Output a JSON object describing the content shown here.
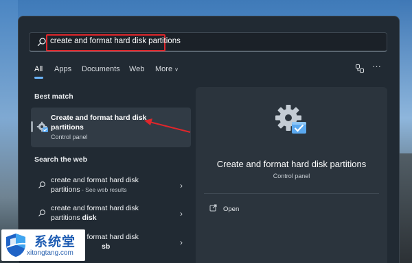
{
  "search": {
    "query": "create and format hard disk partitions",
    "highlight_color": "#e0262b"
  },
  "tabs": [
    {
      "label": "All",
      "active": true
    },
    {
      "label": "Apps"
    },
    {
      "label": "Documents"
    },
    {
      "label": "Web"
    },
    {
      "label": "More"
    }
  ],
  "toolbar": {
    "share_icon": "share-devices-icon",
    "more_icon": "more-ellipsis-icon",
    "more_glyph": "···"
  },
  "best_match": {
    "heading": "Best match",
    "title": "Create and format hard disk partitions",
    "subtitle": "Control panel",
    "icon": "disk-management-gear-icon"
  },
  "web": {
    "heading": "Search the web",
    "items": [
      {
        "line1": "create and format hard disk",
        "line2": "partitions",
        "suffix": " - See web results"
      },
      {
        "line1": "create and format hard disk",
        "line2_prefix": "partitions ",
        "line2_bold": "disk"
      },
      {
        "line1": "create and format hard disk",
        "line2_bold": "sb"
      }
    ]
  },
  "detail": {
    "title": "Create and format hard disk partitions",
    "subtitle": "Control panel",
    "actions": [
      {
        "label": "Open",
        "icon": "open-external-icon"
      }
    ]
  },
  "watermark": {
    "title": "系统堂",
    "url": "xitongtang.com"
  },
  "colors": {
    "accent": "#6cb6ff",
    "panel_bg": "#212a33",
    "card_bg": "#313b45",
    "annotation_red": "#e0262b"
  }
}
